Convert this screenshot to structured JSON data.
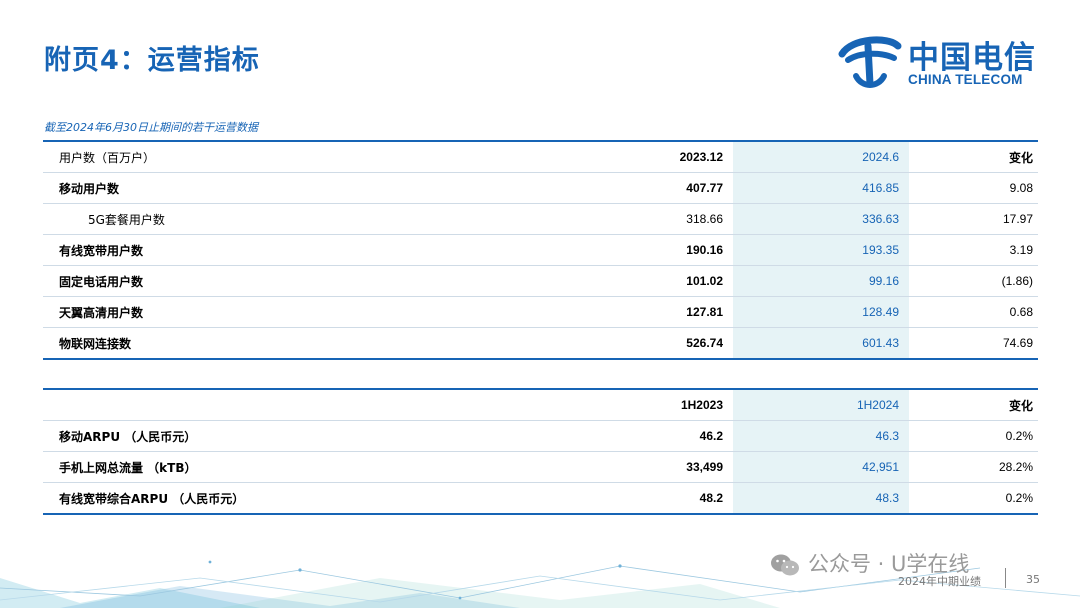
{
  "header": {
    "title": "附页4：运营指标",
    "logo_cn": "中国电信",
    "logo_en": "CHINA TELECOM"
  },
  "subtitle": "截至2024年6月30日止期间的若干运营数据",
  "table1": {
    "header": [
      "用户数（百万户）",
      "2023.12",
      "2024.6",
      "变化"
    ],
    "rows": [
      {
        "label": "移动用户数",
        "prev": "407.77",
        "curr": "416.85",
        "change": "9.08"
      },
      {
        "label": "5G套餐用户数",
        "prev": "318.66",
        "curr": "336.63",
        "change": "17.97"
      },
      {
        "label": "有线宽带用户数",
        "prev": "190.16",
        "curr": "193.35",
        "change": "3.19"
      },
      {
        "label": "固定电话用户数",
        "prev": "101.02",
        "curr": "99.16",
        "change": "(1.86)"
      },
      {
        "label": "天翼高清用户数",
        "prev": "127.81",
        "curr": "128.49",
        "change": "0.68"
      },
      {
        "label": "物联网连接数",
        "prev": "526.74",
        "curr": "601.43",
        "change": "74.69"
      }
    ]
  },
  "table2": {
    "header": [
      "",
      "1H2023",
      "1H2024",
      "变化"
    ],
    "rows": [
      {
        "label": "移动ARPU （人民币元）",
        "prev": "46.2",
        "curr": "46.3",
        "change": "0.2%"
      },
      {
        "label": "手机上网总流量 （kTB）",
        "prev": "33,499",
        "curr": "42,951",
        "change": "28.2%"
      },
      {
        "label": "有线宽带综合ARPU （人民币元）",
        "prev": "48.2",
        "curr": "48.3",
        "change": "0.2%"
      }
    ]
  },
  "watermark": "公众号 · U学在线",
  "footer": {
    "text": "2024年中期业绩",
    "page": "35"
  },
  "colors": {
    "brand_blue": "#1764b5",
    "highlight_column": "#e6f3f6"
  }
}
